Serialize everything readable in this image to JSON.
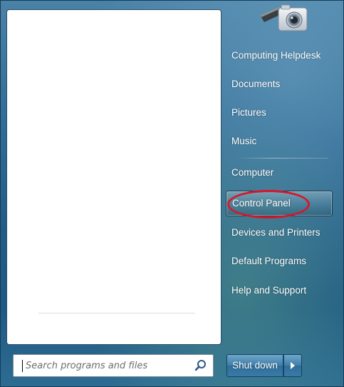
{
  "search": {
    "placeholder": "Search programs and files",
    "icon": "magnifier-icon"
  },
  "right_pane": {
    "items": [
      {
        "label": "Computing Helpdesk"
      },
      {
        "label": "Documents"
      },
      {
        "label": "Pictures"
      },
      {
        "label": "Music"
      },
      {
        "label": "Computer"
      },
      {
        "label": "Control Panel",
        "selected": true
      },
      {
        "label": "Devices and Printers"
      },
      {
        "label": "Default Programs"
      },
      {
        "label": "Help and Support"
      }
    ],
    "user_picture_icon": "camera-icon"
  },
  "shutdown": {
    "label": "Shut down",
    "options_icon": "arrow-right-icon"
  },
  "colors": {
    "highlight_annotation": "#d6172a",
    "menu_blue": "#2f6a93"
  }
}
